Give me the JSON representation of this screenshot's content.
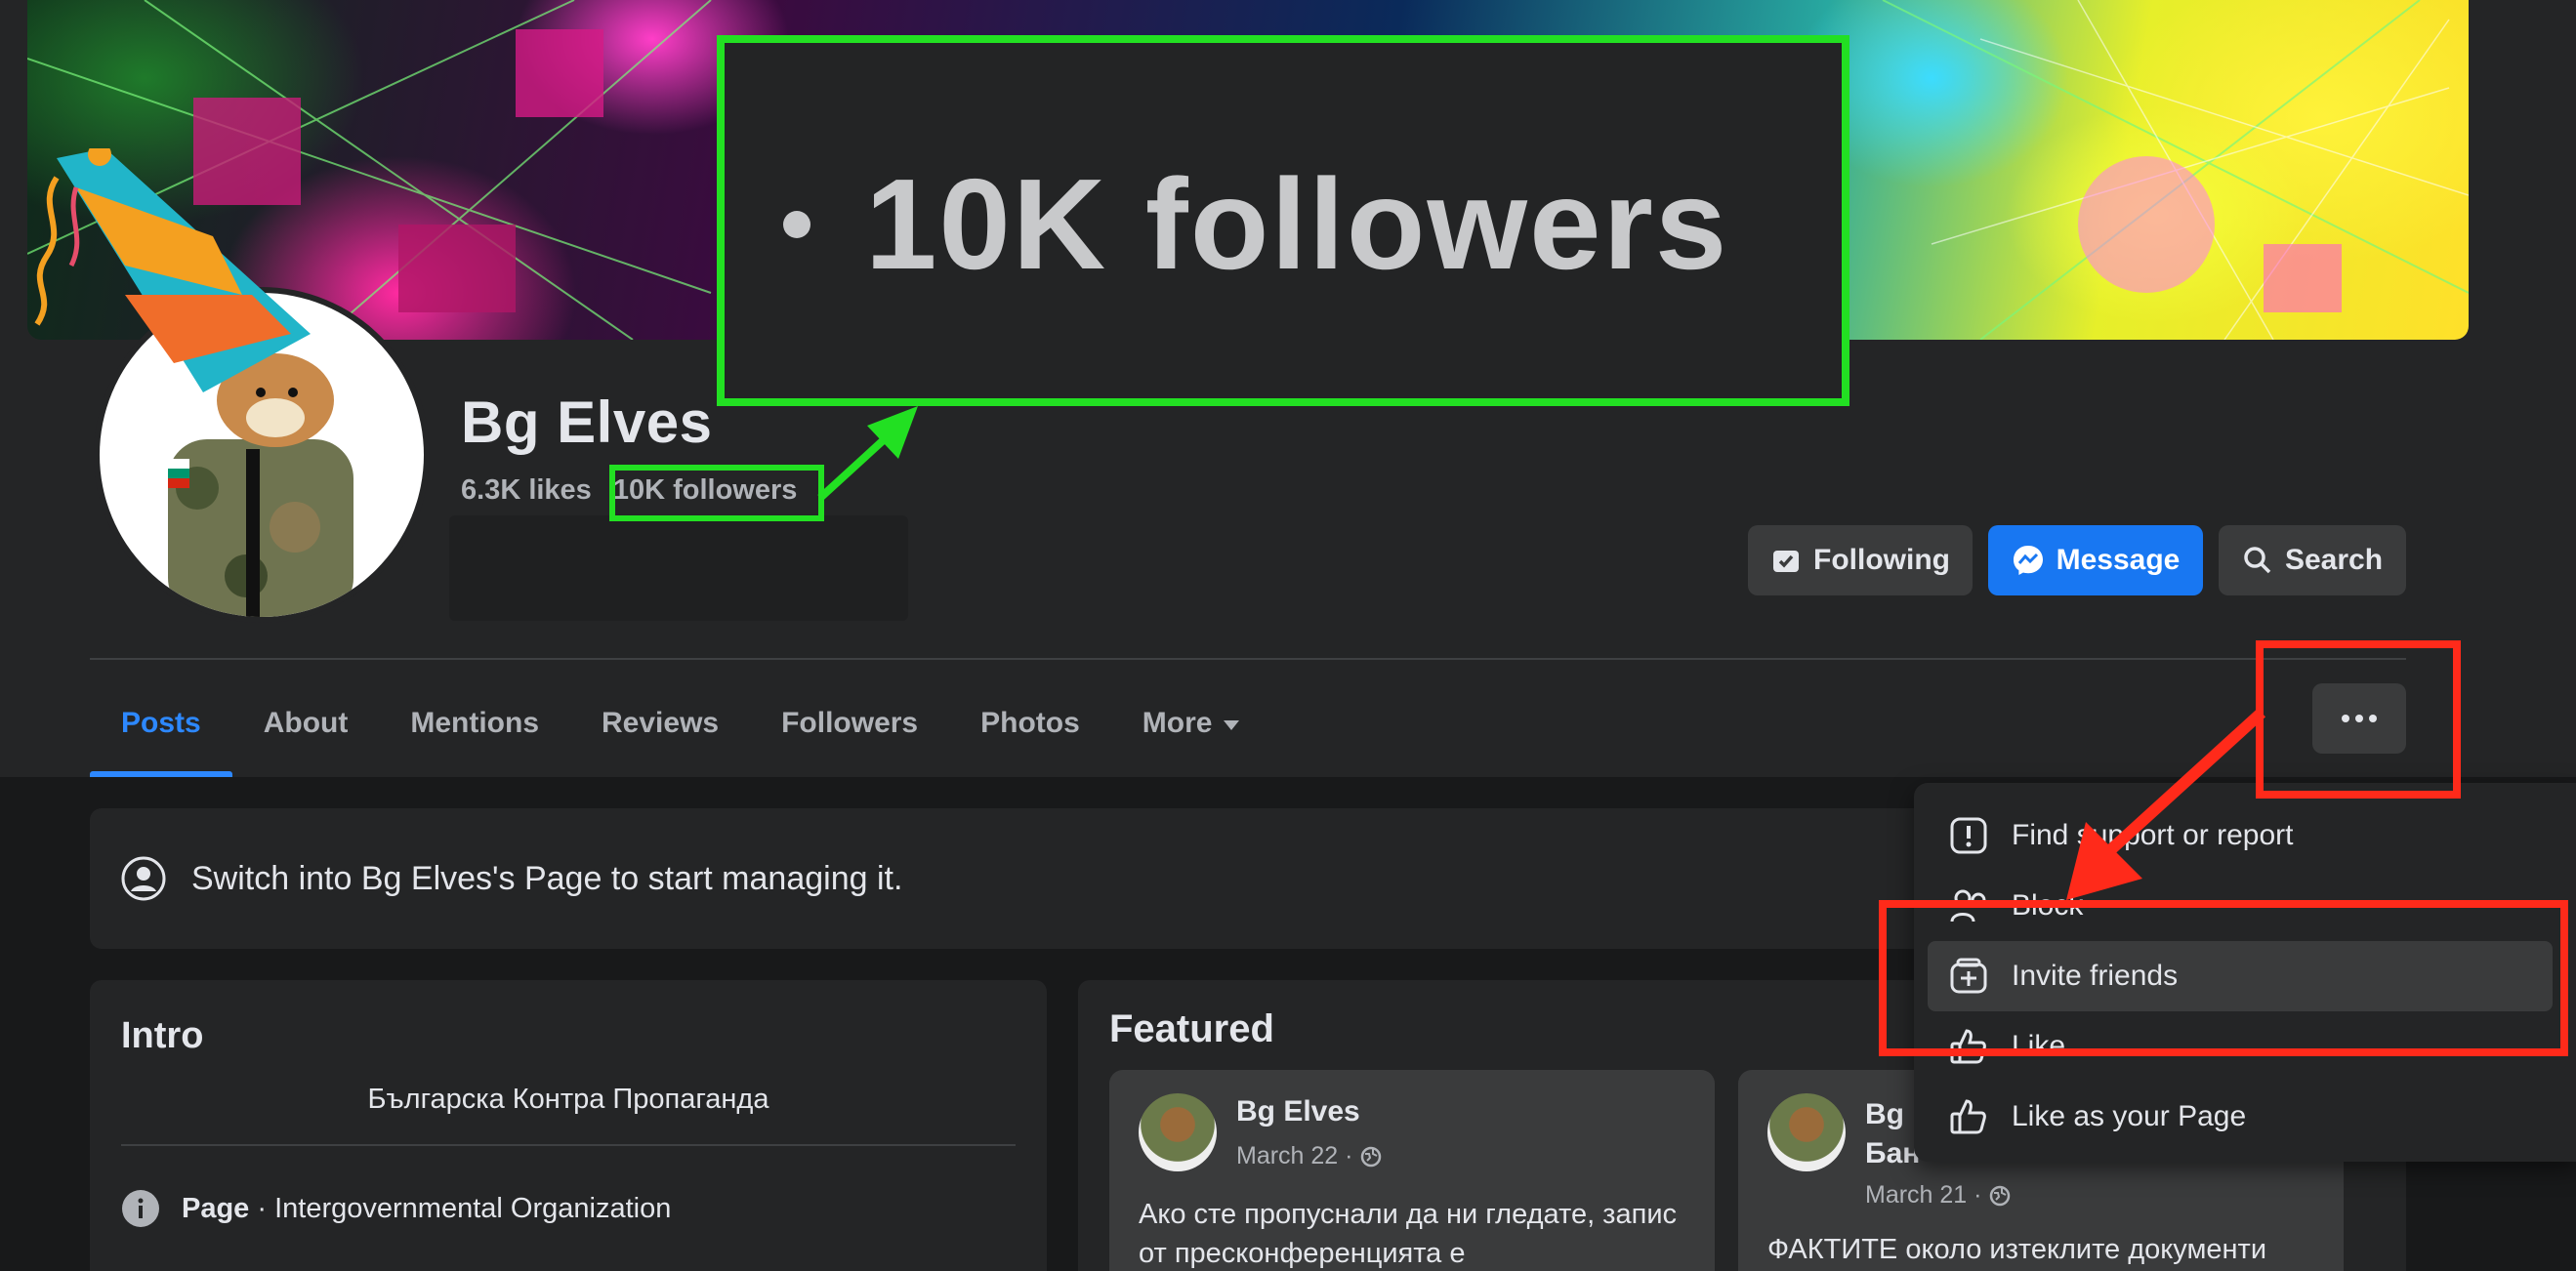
{
  "page": {
    "name": "Bg Elves",
    "likes": "6.3K likes",
    "followers": "10K followers",
    "zoom_followers": "10K followers"
  },
  "actions": {
    "following": "Following",
    "message": "Message",
    "search": "Search"
  },
  "tabs": [
    {
      "label": "Posts",
      "active": true
    },
    {
      "label": "About"
    },
    {
      "label": "Mentions"
    },
    {
      "label": "Reviews"
    },
    {
      "label": "Followers"
    },
    {
      "label": "Photos"
    },
    {
      "label": "More"
    }
  ],
  "switch_banner": "Switch into Bg Elves's Page to start managing it.",
  "intro": {
    "title": "Intro",
    "bio": "Българска Контра Пропаганда",
    "page_label": "Page",
    "category": " · Intergovernmental Organization"
  },
  "featured": {
    "title": "Featured",
    "posts": [
      {
        "author": "Bg Elves",
        "date": "March 22 ·",
        "text": "Ако сте пропуснали да ни гледате, запис от пресконференцията е"
      },
      {
        "author": "Bg Elves",
        "author_line2": "Бан",
        "date": "March 21 ·",
        "text": "ФАКТИТЕ около изтеклите документи"
      }
    ]
  },
  "menu": {
    "items": [
      {
        "label": "Find support or report",
        "icon": "report-icon"
      },
      {
        "label": "Block",
        "icon": "block-icon"
      },
      {
        "label": "Invite friends",
        "icon": "invite-icon"
      },
      {
        "label": "Like",
        "icon": "like-icon"
      },
      {
        "label": "Like as your Page",
        "icon": "like-icon"
      }
    ]
  },
  "colors": {
    "accent": "#1877f2",
    "active_tab": "#2d88ff",
    "annotation_green": "#22e022",
    "annotation_red": "#ff2a1a"
  }
}
